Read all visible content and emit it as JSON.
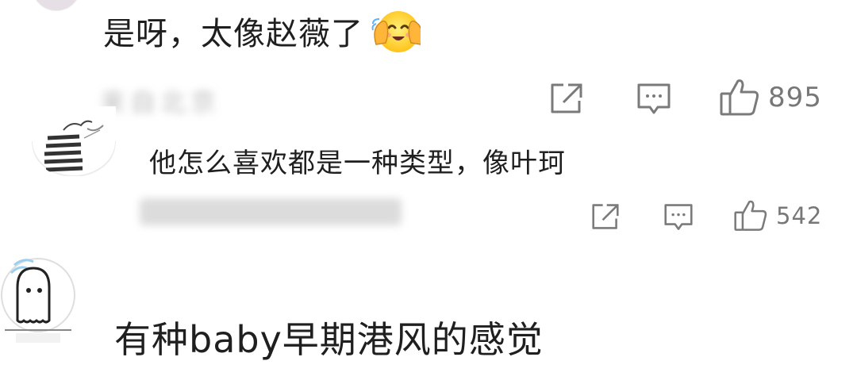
{
  "comments": [
    {
      "text": "是呀，太像赵薇了",
      "emoji": "smiling-face-with-hand-over-mouth-emoji",
      "meta": "来自北京",
      "actions": {
        "likes": "895"
      }
    },
    {
      "text": "他怎么喜欢都是一种类型，像叶珂",
      "meta": "",
      "actions": {
        "likes": "542"
      }
    },
    {
      "text": "有种baby早期港风的感觉"
    }
  ],
  "icons": {
    "share": "share-icon",
    "reply": "comment-icon",
    "like": "thumbs-up-icon"
  },
  "colors": {
    "text": "#1f1f1f",
    "icon": "#7a7a7a",
    "meta_blur": "#bdbdbd",
    "emoji_yellow": "#ffd34d",
    "emoji_hand": "#ffb53a",
    "background": "#ffffff"
  }
}
